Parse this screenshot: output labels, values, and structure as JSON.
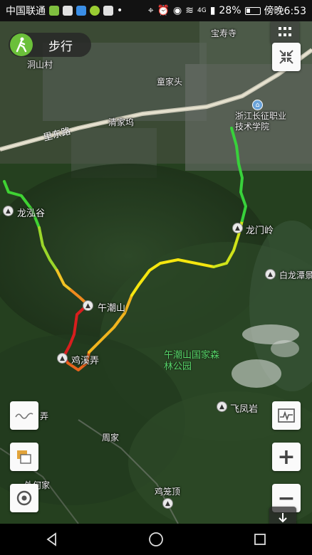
{
  "status_bar": {
    "carrier": "中国联通",
    "battery": "28%",
    "time": "傍晚6:53",
    "network": "4G"
  },
  "mode": {
    "label": "步行",
    "icon": "walking-person-icon"
  },
  "map": {
    "places": {
      "baoshousi": "宝寿寺",
      "dongshancun": "洞山村",
      "tongjiatou": "童家头",
      "qingjiawu": "清家坞",
      "lidonglu": "里东路",
      "school": "浙江长征职业技术学院",
      "longgu": "龙泓谷",
      "longmenling": "龙门岭",
      "bailongtan": "白龙潭景",
      "wuchaoshan": "午潮山",
      "jixinong": "鸡溪弄",
      "park": "午潮山国家森林公园",
      "feifengyan": "飞凤岩",
      "zhoujia": "周家",
      "left_edge_label": "弄",
      "jiajiajia": "外何家",
      "jilongding": "鸡笼顶"
    },
    "track_colors": {
      "start": "#2ecc2e",
      "mid": "#f5e600",
      "end": "#d61e1e"
    }
  },
  "controls": {
    "layers_icon": "grid-menu-icon",
    "fit_icon": "collapse-arrows-icon",
    "elevation_icon": "wave-profile-icon",
    "map_style_icon": "map-layers-icon",
    "locate_icon": "locate-target-icon",
    "chart_icon": "chart-pulse-icon",
    "zoom_in": "+",
    "zoom_out": "−",
    "download_icon": "download-arrow-icon"
  },
  "nav_bar": {
    "back": "back-triangle-icon",
    "home": "home-circle-icon",
    "recents": "recents-square-icon"
  }
}
